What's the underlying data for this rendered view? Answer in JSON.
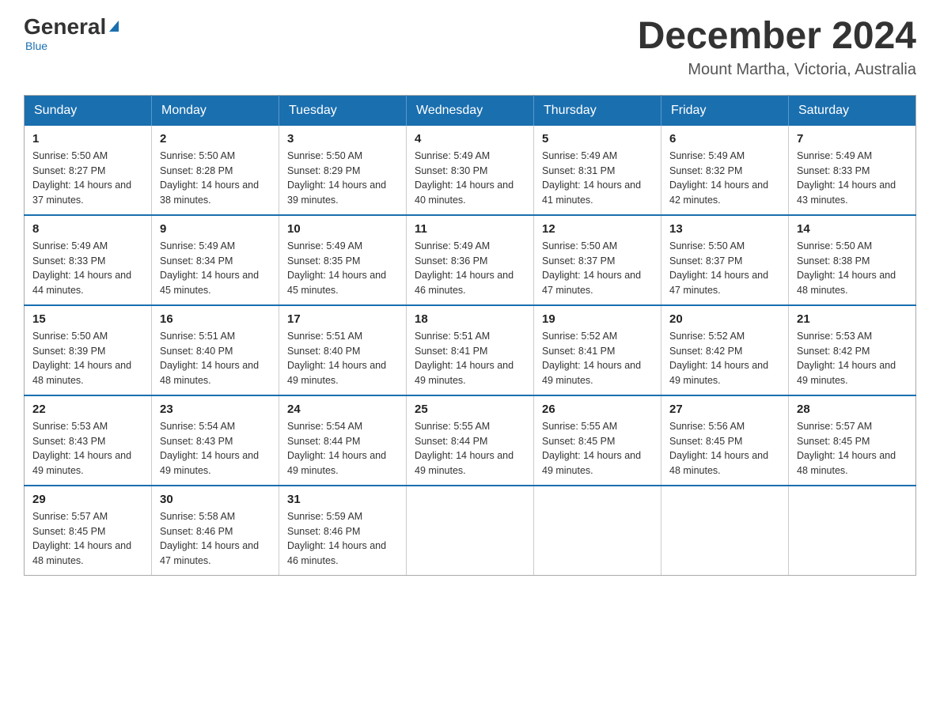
{
  "header": {
    "logo": {
      "general": "General",
      "triangle": "▲",
      "blue": "Blue"
    },
    "title": "December 2024",
    "location": "Mount Martha, Victoria, Australia"
  },
  "weekdays": [
    "Sunday",
    "Monday",
    "Tuesday",
    "Wednesday",
    "Thursday",
    "Friday",
    "Saturday"
  ],
  "weeks": [
    [
      {
        "day": "1",
        "sunrise": "5:50 AM",
        "sunset": "8:27 PM",
        "daylight": "14 hours and 37 minutes."
      },
      {
        "day": "2",
        "sunrise": "5:50 AM",
        "sunset": "8:28 PM",
        "daylight": "14 hours and 38 minutes."
      },
      {
        "day": "3",
        "sunrise": "5:50 AM",
        "sunset": "8:29 PM",
        "daylight": "14 hours and 39 minutes."
      },
      {
        "day": "4",
        "sunrise": "5:49 AM",
        "sunset": "8:30 PM",
        "daylight": "14 hours and 40 minutes."
      },
      {
        "day": "5",
        "sunrise": "5:49 AM",
        "sunset": "8:31 PM",
        "daylight": "14 hours and 41 minutes."
      },
      {
        "day": "6",
        "sunrise": "5:49 AM",
        "sunset": "8:32 PM",
        "daylight": "14 hours and 42 minutes."
      },
      {
        "day": "7",
        "sunrise": "5:49 AM",
        "sunset": "8:33 PM",
        "daylight": "14 hours and 43 minutes."
      }
    ],
    [
      {
        "day": "8",
        "sunrise": "5:49 AM",
        "sunset": "8:33 PM",
        "daylight": "14 hours and 44 minutes."
      },
      {
        "day": "9",
        "sunrise": "5:49 AM",
        "sunset": "8:34 PM",
        "daylight": "14 hours and 45 minutes."
      },
      {
        "day": "10",
        "sunrise": "5:49 AM",
        "sunset": "8:35 PM",
        "daylight": "14 hours and 45 minutes."
      },
      {
        "day": "11",
        "sunrise": "5:49 AM",
        "sunset": "8:36 PM",
        "daylight": "14 hours and 46 minutes."
      },
      {
        "day": "12",
        "sunrise": "5:50 AM",
        "sunset": "8:37 PM",
        "daylight": "14 hours and 47 minutes."
      },
      {
        "day": "13",
        "sunrise": "5:50 AM",
        "sunset": "8:37 PM",
        "daylight": "14 hours and 47 minutes."
      },
      {
        "day": "14",
        "sunrise": "5:50 AM",
        "sunset": "8:38 PM",
        "daylight": "14 hours and 48 minutes."
      }
    ],
    [
      {
        "day": "15",
        "sunrise": "5:50 AM",
        "sunset": "8:39 PM",
        "daylight": "14 hours and 48 minutes."
      },
      {
        "day": "16",
        "sunrise": "5:51 AM",
        "sunset": "8:40 PM",
        "daylight": "14 hours and 48 minutes."
      },
      {
        "day": "17",
        "sunrise": "5:51 AM",
        "sunset": "8:40 PM",
        "daylight": "14 hours and 49 minutes."
      },
      {
        "day": "18",
        "sunrise": "5:51 AM",
        "sunset": "8:41 PM",
        "daylight": "14 hours and 49 minutes."
      },
      {
        "day": "19",
        "sunrise": "5:52 AM",
        "sunset": "8:41 PM",
        "daylight": "14 hours and 49 minutes."
      },
      {
        "day": "20",
        "sunrise": "5:52 AM",
        "sunset": "8:42 PM",
        "daylight": "14 hours and 49 minutes."
      },
      {
        "day": "21",
        "sunrise": "5:53 AM",
        "sunset": "8:42 PM",
        "daylight": "14 hours and 49 minutes."
      }
    ],
    [
      {
        "day": "22",
        "sunrise": "5:53 AM",
        "sunset": "8:43 PM",
        "daylight": "14 hours and 49 minutes."
      },
      {
        "day": "23",
        "sunrise": "5:54 AM",
        "sunset": "8:43 PM",
        "daylight": "14 hours and 49 minutes."
      },
      {
        "day": "24",
        "sunrise": "5:54 AM",
        "sunset": "8:44 PM",
        "daylight": "14 hours and 49 minutes."
      },
      {
        "day": "25",
        "sunrise": "5:55 AM",
        "sunset": "8:44 PM",
        "daylight": "14 hours and 49 minutes."
      },
      {
        "day": "26",
        "sunrise": "5:55 AM",
        "sunset": "8:45 PM",
        "daylight": "14 hours and 49 minutes."
      },
      {
        "day": "27",
        "sunrise": "5:56 AM",
        "sunset": "8:45 PM",
        "daylight": "14 hours and 48 minutes."
      },
      {
        "day": "28",
        "sunrise": "5:57 AM",
        "sunset": "8:45 PM",
        "daylight": "14 hours and 48 minutes."
      }
    ],
    [
      {
        "day": "29",
        "sunrise": "5:57 AM",
        "sunset": "8:45 PM",
        "daylight": "14 hours and 48 minutes."
      },
      {
        "day": "30",
        "sunrise": "5:58 AM",
        "sunset": "8:46 PM",
        "daylight": "14 hours and 47 minutes."
      },
      {
        "day": "31",
        "sunrise": "5:59 AM",
        "sunset": "8:46 PM",
        "daylight": "14 hours and 46 minutes."
      },
      null,
      null,
      null,
      null
    ]
  ]
}
